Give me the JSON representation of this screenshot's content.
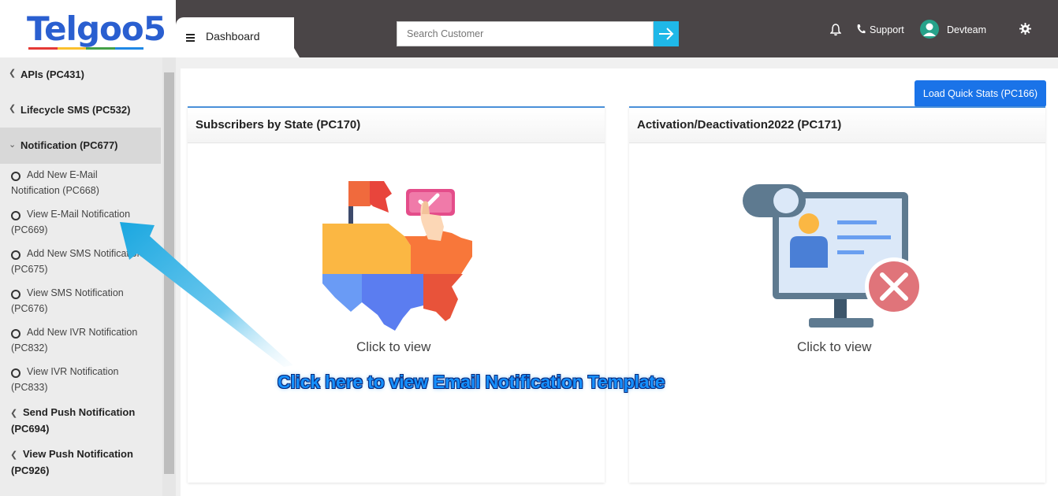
{
  "brand": {
    "logo_text": "Telgoo5",
    "logo_bar_colors": [
      "#e53935",
      "#fbc02d",
      "#43a047",
      "#1e88e5"
    ]
  },
  "sidebar": {
    "items": [
      {
        "label": "APIs (PC431)",
        "icon": "chevron-left-icon"
      },
      {
        "label": "Lifecycle SMS (PC532)",
        "icon": "chevron-left-icon"
      },
      {
        "label": "Notification (PC677)",
        "icon": "chevron-down-icon",
        "active": true
      }
    ],
    "sub_items": [
      {
        "line1": "Add New E-Mail",
        "line2": "Notification (PC668)"
      },
      {
        "line1": "View E-Mail Notification",
        "line2": "(PC669)"
      },
      {
        "line1": "Add New SMS Notification",
        "line2": "(PC675)"
      },
      {
        "line1": "View SMS Notification",
        "line2": "(PC676)"
      },
      {
        "line1": "Add New IVR Notification",
        "line2": "(PC832)"
      },
      {
        "line1": "View IVR Notification",
        "line2": "(PC833)"
      }
    ],
    "bold_items": [
      {
        "line1": "Send Push Notification",
        "line2": "(PC694)"
      },
      {
        "line1": "View Push Notification",
        "line2": "(PC926)"
      }
    ]
  },
  "header": {
    "tab_label": "Dashboard",
    "search_placeholder": "Search Customer",
    "support_label": "Support",
    "user_name": "Devteam",
    "accent": "#1fb8e8"
  },
  "main": {
    "quick_stats_label": "Load Quick Stats (PC166)",
    "cards": [
      {
        "title": "Subscribers by State (PC170)",
        "cta": "Click to view",
        "icon": "us-map-icon"
      },
      {
        "title": "Activation/Deactivation2022 (PC171)",
        "cta": "Click to view",
        "icon": "monitor-deactivate-icon"
      }
    ]
  },
  "annotation": {
    "callout_text": "Click here to view Email Notification Template"
  }
}
